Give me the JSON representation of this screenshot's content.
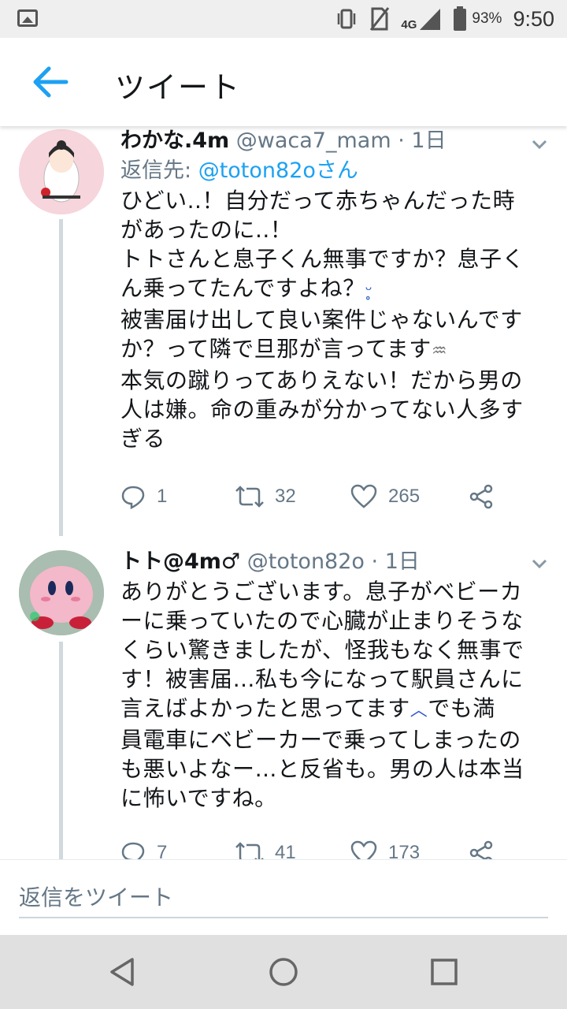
{
  "status_bar": {
    "battery": "93%",
    "time": "9:50",
    "network": "4G",
    "icons": [
      "image-icon",
      "vibrate-icon",
      "no-sim-icon",
      "signal-icon",
      "battery-icon"
    ]
  },
  "header": {
    "title": "ツイート",
    "back_icon": "back-arrow-icon"
  },
  "tweets": [
    {
      "name": "わかな.4m",
      "handle": "@waca7_mam",
      "time": "· 1日",
      "reply_label": "返信先: ",
      "reply_to": "@toton82oさん",
      "text": "ひどい..！自分だって赤ちゃんだった時\nがあったのに..！\nトトさんと息子くん無事ですか？息子く\nん乗ってたんですよね？",
      "emoji1": "ᵕ̥",
      "text2": "\n被害届け出して良い案件じゃないんです\nか？って隣で旦那が言ってます",
      "emoji2": "♒",
      "text3": "\n本気の蹴りってありえない！だから男の\n人は嫌。命の重みが分かってない人多す\nぎる",
      "replies": "1",
      "retweets": "32",
      "likes": "265"
    },
    {
      "name": "トト@4m♂",
      "handle": "@toton82o",
      "time": "· 1日",
      "text": "ありがとうございます。息子がベビーカ\nーに乗っていたので心臓が止まりそうな\nくらい驚きましたが、怪我もなく無事で\nす！被害届…私も今になって駅員さんに\n言えばよかったと思ってます",
      "emoji1": "︿",
      "text2": "でも満\n員電車にベビーカーで乗ってしまったの\nも悪いよなー…と反省も。男の人は本当\nに怖いですね。",
      "replies": "7",
      "retweets": "41",
      "likes": "173"
    }
  ],
  "composer": {
    "placeholder": "返信をツイート"
  },
  "colors": {
    "accent": "#1da1f2",
    "text": "#14171a",
    "muted": "#657786"
  }
}
